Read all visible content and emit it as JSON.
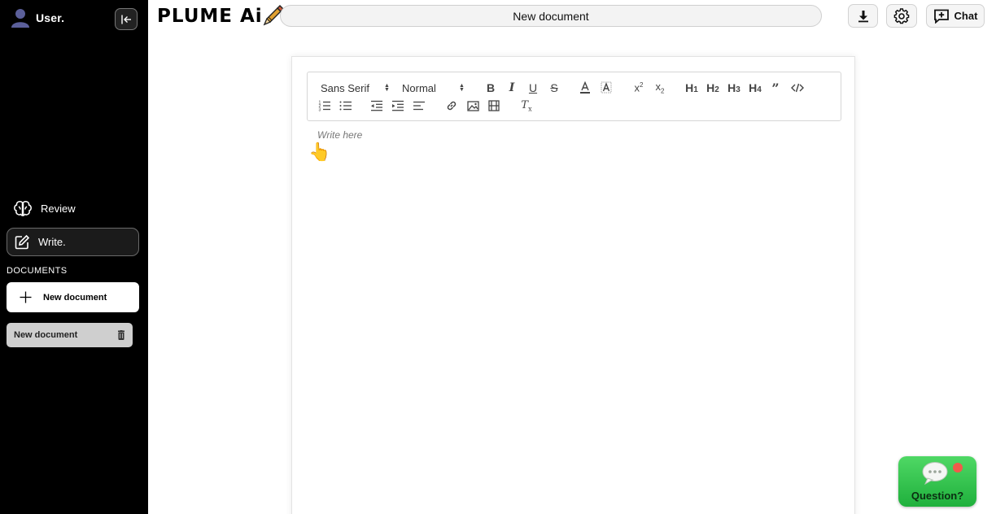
{
  "sidebar": {
    "user_name": "User.",
    "nav": [
      {
        "label": "Review",
        "icon": "brain-icon"
      },
      {
        "label": "Write.",
        "icon": "edit-icon",
        "active": true
      }
    ],
    "section_title": "DOCUMENTS",
    "new_document_label": "New document",
    "documents": [
      {
        "title": "New document"
      }
    ]
  },
  "header": {
    "brand": "PLUME Ai",
    "document_title": "New document",
    "chat_label": "Chat"
  },
  "editor": {
    "font_family": "Sans Serif",
    "font_size": "Normal",
    "placeholder": "Write here",
    "toolbar_buttons": [
      "bold",
      "italic",
      "underline",
      "strike",
      "color",
      "background",
      "superscript",
      "subscript",
      "h1",
      "h2",
      "h3",
      "h4",
      "blockquote",
      "code",
      "ordered-list",
      "bullet-list",
      "indent-decrease",
      "indent-increase",
      "align",
      "link",
      "image",
      "video",
      "clean"
    ]
  },
  "floating": {
    "question_label": "Question?"
  },
  "colors": {
    "sidebar_bg": "#000000",
    "question_green": "#2bc04a",
    "notification": "#f15a4a"
  }
}
